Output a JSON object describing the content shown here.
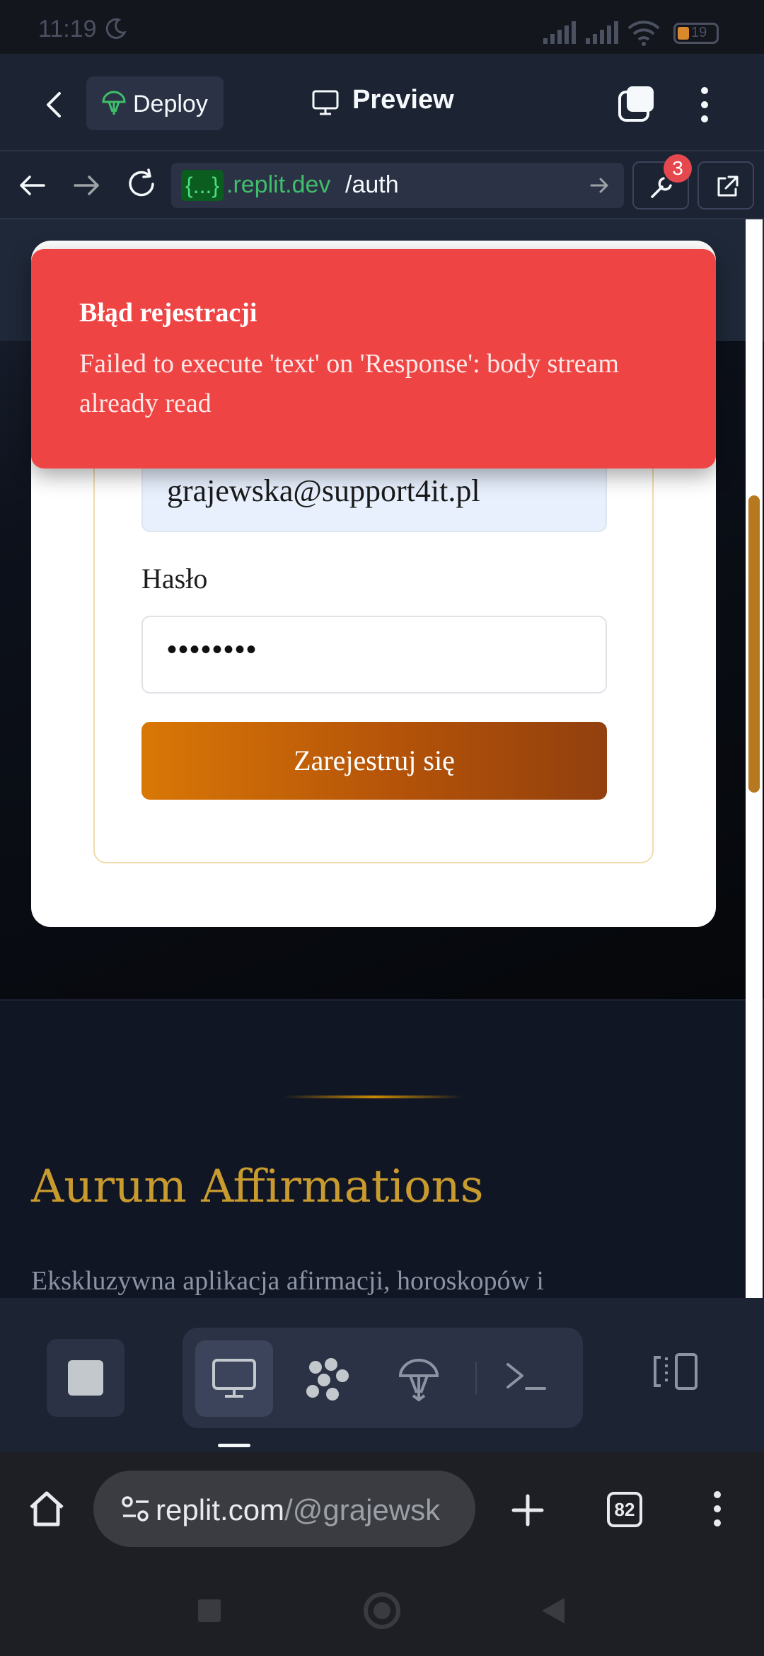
{
  "status_bar": {
    "time": "11:19",
    "battery": "19"
  },
  "topbar": {
    "deploy_label": "Deploy",
    "preview_title": "Preview"
  },
  "browser": {
    "url_badge": "{...}",
    "url_host": ".replit.dev",
    "url_path": "/auth",
    "devtools_badge": "3"
  },
  "toast": {
    "title": "Błąd rejestracji",
    "message": "Failed to execute 'text' on 'Response': body stream already read"
  },
  "form": {
    "email_value": "grajewska@support4it.pl",
    "password_label": "Hasło",
    "password_value": "••••••••",
    "submit_label": "Zarejestruj się"
  },
  "footer": {
    "brand": "Aurum Affirmations",
    "tagline": "Ekskluzywna aplikacja afirmacji, horoskopów i"
  },
  "chrome": {
    "omnibox_host": "replit.com",
    "omnibox_rest": "/@grajewsk",
    "tab_count": "82"
  },
  "colors": {
    "replit_bg": "#1c2333",
    "toast_red": "#ef4444",
    "gold": "#c99a2e",
    "button_orange": "#d97706"
  }
}
